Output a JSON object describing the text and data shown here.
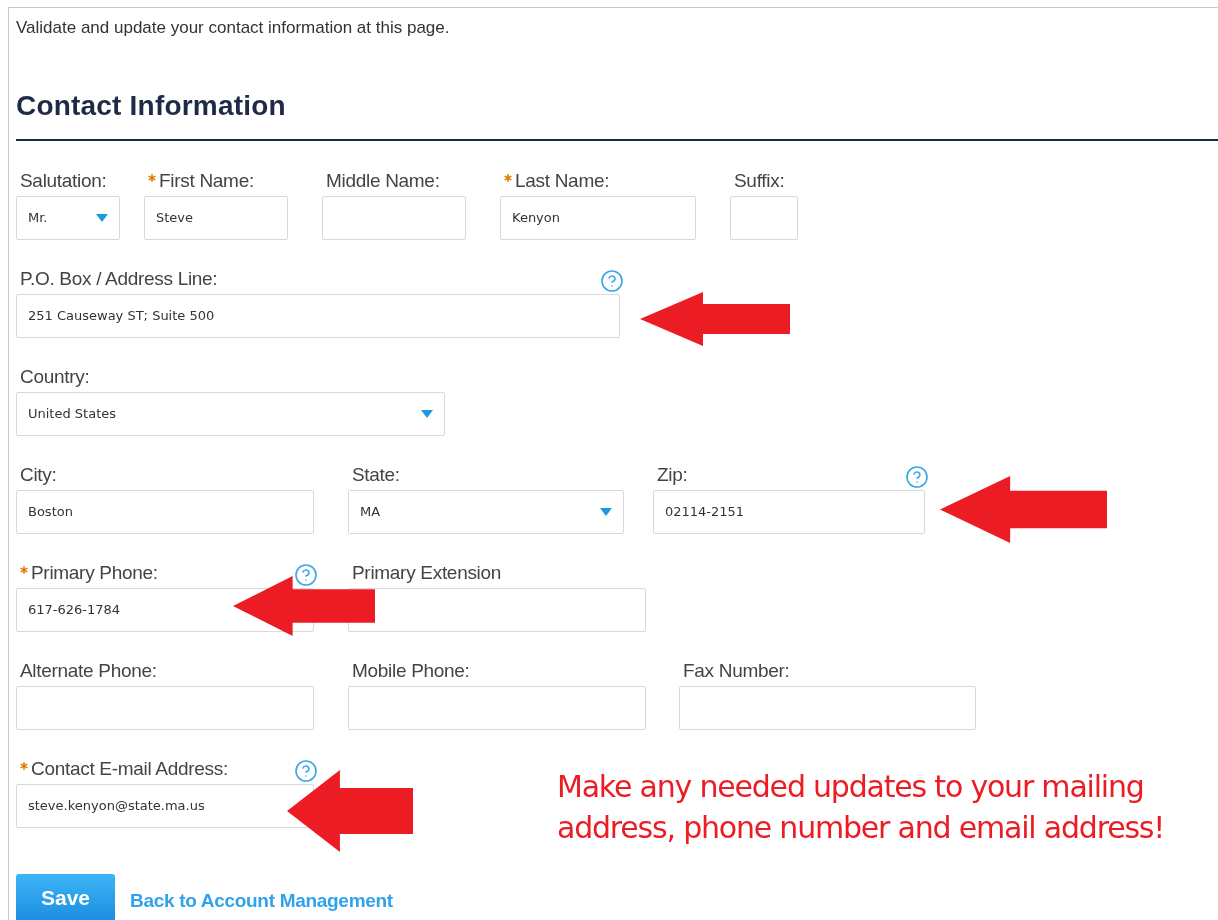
{
  "intro": "Validate and update your contact information at this page.",
  "heading": "Contact Information",
  "rows": [
    [
      {
        "label": "Salutation:",
        "required": false,
        "kind": "select",
        "value": "Mr."
      },
      {
        "label": "First Name:",
        "required": true,
        "kind": "text",
        "value": "Steve"
      },
      {
        "label": "Middle Name:",
        "required": false,
        "kind": "text"
      },
      {
        "label": "Last Name:",
        "required": true,
        "kind": "text",
        "value": "Kenyon"
      },
      {
        "label": "Suffix:",
        "required": false,
        "kind": "text"
      }
    ],
    [
      {
        "label": "P.O. Box / Address Line:",
        "required": false,
        "kind": "text",
        "value": "251 Causeway ST; Suite 500",
        "help": true
      }
    ],
    [
      {
        "label": "Country:",
        "required": false,
        "kind": "select",
        "value": "United States"
      }
    ],
    [
      {
        "label": "City:",
        "required": false,
        "kind": "text",
        "value": "Boston"
      },
      {
        "label": "State:",
        "required": false,
        "kind": "select",
        "value": "MA"
      },
      {
        "label": "Zip:",
        "required": false,
        "kind": "text",
        "value": "02114-2151",
        "help": true
      }
    ],
    [
      {
        "label": "Primary Phone:",
        "required": true,
        "kind": "text",
        "value": "617-626-1784",
        "help": true
      },
      {
        "label": "Primary Extension",
        "required": false,
        "kind": "text"
      }
    ],
    [
      {
        "label": "Alternate Phone:",
        "required": false,
        "kind": "text"
      },
      {
        "label": "Mobile Phone:",
        "required": false,
        "kind": "text"
      },
      {
        "label": "Fax Number:",
        "required": false,
        "kind": "text"
      }
    ],
    [
      {
        "label": "Contact E-mail Address:",
        "required": true,
        "kind": "text",
        "value": "steve.kenyon@state.ma.us",
        "help": true
      }
    ]
  ],
  "note": "Make any needed updates to your mailing address, phone number and email address!",
  "actions": [
    {
      "kind": "primary",
      "label": "Save"
    },
    {
      "kind": "link",
      "label": "Back to Account Management"
    }
  ]
}
